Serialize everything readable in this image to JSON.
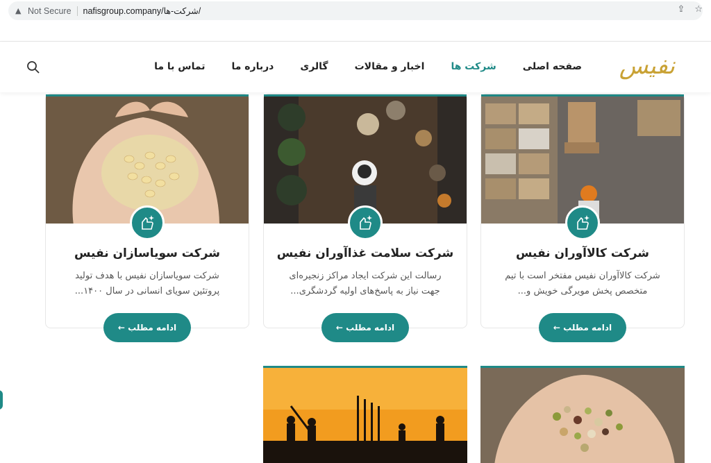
{
  "browser": {
    "warning": "Not Secure",
    "url": "nafisgroup.company/شرکت-ها/"
  },
  "header": {
    "logo": "نفیس",
    "nav": [
      "صفحه اصلی",
      "شرکت ها",
      "اخبار و مقالات",
      "گالری",
      "درباره ما",
      "تماس با ما"
    ],
    "active_index": 1
  },
  "cards": [
    {
      "title": "شرکت کالاآوران نفیس",
      "desc": "شرکت کالاآوران نفیس مفتخر است با تیم متخصص پخش مویرگی خویش و...",
      "button": "ادامه مطلب ←"
    },
    {
      "title": "شرکت سلامت غذاآوران نفیس",
      "desc": "رسالت این شرکت ایجاد مراکز زنجیره‌ای جهت نیاز به پاسخ‌های اولیه گردشگری...",
      "button": "ادامه مطلب ←"
    },
    {
      "title": "شرکت سویاسازان نفیس",
      "desc": "شرکت سویاسازان نفیس با هدف تولید پروتئین سویای انسانی در سال ۱۴۰۰...",
      "button": "ادامه مطلب ←"
    }
  ],
  "colors": {
    "accent": "#1f8a87",
    "logo": "#c9a235"
  }
}
